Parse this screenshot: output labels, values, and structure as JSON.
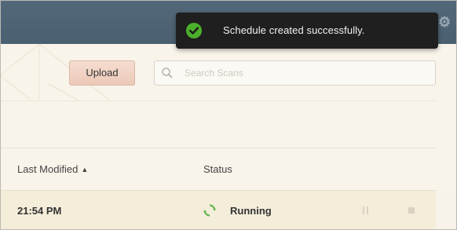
{
  "toolbar": {
    "upload_label": "Upload",
    "search_placeholder": "Search Scans"
  },
  "table": {
    "headers": {
      "last_modified": "Last Modified",
      "status": "Status"
    },
    "sort": "ascending",
    "rows": [
      {
        "last_modified": "21:54 PM",
        "status": "Running"
      }
    ]
  },
  "toast": {
    "message": "Schedule created successfully."
  },
  "icons": {
    "top_bar": [
      "bell-icon",
      "gear-icon"
    ],
    "search": "search-icon",
    "sort": "sort-up-icon",
    "row_status": "refresh-icon",
    "row_actions": [
      "pause-icon",
      "stop-icon"
    ],
    "toast": "check-circle-icon"
  },
  "colors": {
    "top_bar": "#4e6373",
    "background": "#f7f3e9",
    "row_highlight": "#f4edda",
    "upload_button": "#f0d2c3",
    "toast_background": "#1f1f1f",
    "success_green": "#4caf2c",
    "running_green": "#5bb346"
  }
}
